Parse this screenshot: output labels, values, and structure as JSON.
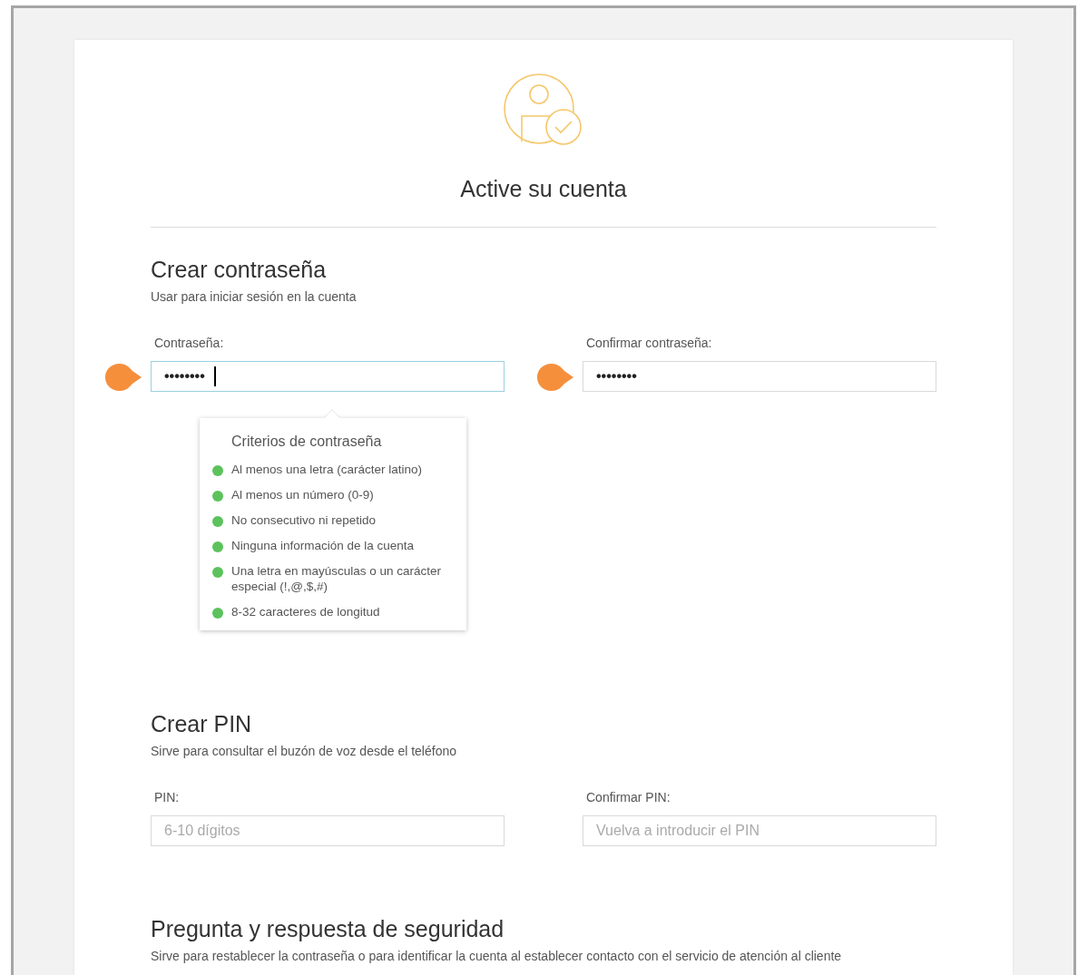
{
  "title": "Active su cuenta",
  "sections": [
    {
      "heading": "Crear contraseña",
      "subtitle": "Usar para iniciar sesión en la cuenta",
      "fields": [
        {
          "label": "Contraseña:",
          "value": "••••••••",
          "focused": true,
          "highlighted": true
        },
        {
          "label": "Confirmar contraseña:",
          "value": "••••••••",
          "focused": false,
          "highlighted": true
        }
      ],
      "criteria_popup": {
        "title": "Criterios de contraseña",
        "items": [
          {
            "text": "Al menos una letra (carácter latino)",
            "met": true
          },
          {
            "text": "Al menos un número (0-9)",
            "met": true
          },
          {
            "text": "No consecutivo ni repetido",
            "met": true
          },
          {
            "text": "Ninguna información de la cuenta",
            "met": true
          },
          {
            "text": "Una letra en mayúsculas o un carácter especial (!,@,$,#)",
            "met": true
          },
          {
            "text": "8-32 caracteres de longitud",
            "met": true
          }
        ]
      }
    },
    {
      "heading": "Crear PIN",
      "subtitle": "Sirve para consultar el buzón de voz desde el teléfono",
      "fields": [
        {
          "label": "PIN:",
          "placeholder": "6-10 dígitos",
          "focused": false,
          "highlighted": false
        },
        {
          "label": "Confirmar PIN:",
          "placeholder": "Vuelva a introducir el PIN",
          "focused": false,
          "highlighted": false
        }
      ]
    },
    {
      "heading": "Pregunta y respuesta de seguridad",
      "subtitle": "Sirve para restablecer la contraseña o para identificar la cuenta al establecer contacto con el servicio de atención al cliente"
    }
  ]
}
